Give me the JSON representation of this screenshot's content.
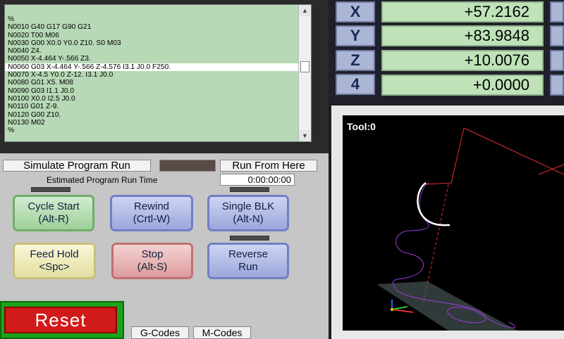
{
  "gcode": {
    "lines": [
      "%",
      "N0010 G40 G17 G90 G21",
      "N0020 T00 M06",
      "N0030 G00 X0.0 Y0.0 Z10. S0 M03",
      "N0040 Z4.",
      "N0050 X-4.464 Y-.566 Z3.",
      "N0060 G03 X-4.464 Y-.566 Z-4.576 I3.1 J0.0 F250.",
      "N0070 X-4.5 Y0.0 Z-12. I3.1 J0.0",
      "N0080 G01 X5. M08",
      "N0090 G03 I1.1 J0.0",
      "N0100 X0.0 I2.5 J0.0",
      "N0110 G01 Z-9.",
      "N0120 G00 Z10.",
      "N0130 M02",
      "%"
    ],
    "selected_index": 6
  },
  "dro": {
    "axes": [
      {
        "name": "X",
        "value": "+57.2162"
      },
      {
        "name": "Y",
        "value": "+83.9848"
      },
      {
        "name": "Z",
        "value": "+10.0076"
      },
      {
        "name": "4",
        "value": "+0.0000"
      }
    ]
  },
  "toolpath": {
    "tool_label": "Tool:0"
  },
  "controls": {
    "simulate_label": "Simulate Program Run",
    "run_from_here_label": "Run From Here",
    "estimated_time_label": "Estimated Program Run Time",
    "estimated_time_value": "0:00:00:00",
    "cycle_start": {
      "line1": "Cycle Start",
      "line2": "(Alt-R)"
    },
    "rewind": {
      "line1": "Rewind",
      "line2": "(Crtl-W)"
    },
    "single_blk": {
      "line1": "Single BLK",
      "line2": "(Alt-N)"
    },
    "feed_hold": {
      "line1": "Feed Hold",
      "line2": "<Spc>"
    },
    "stop": {
      "line1": "Stop",
      "line2": "(Alt-S)"
    },
    "reverse_run": {
      "line1": "Reverse",
      "line2": "Run"
    },
    "reset_label": "Reset",
    "gcodes_label": "G-Codes",
    "mcodes_label": "M-Codes"
  }
}
